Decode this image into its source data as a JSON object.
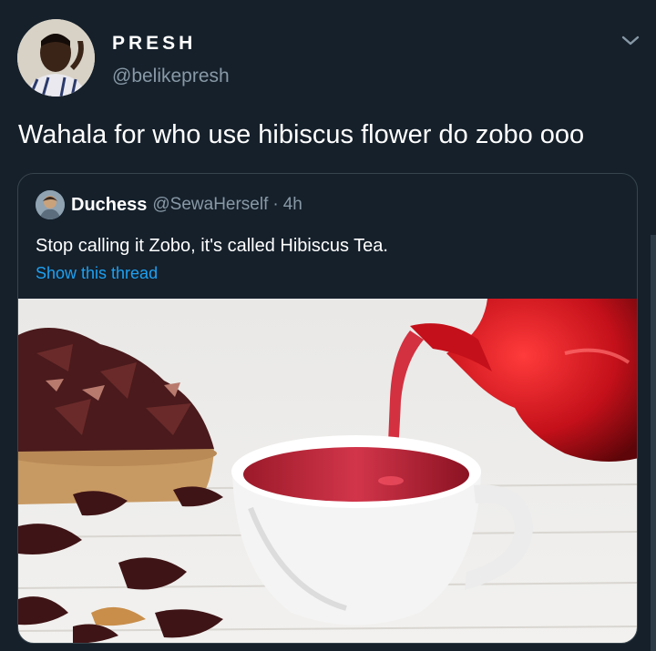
{
  "tweet": {
    "display_name": "PRESH",
    "handle": "@belikepresh",
    "text": "Wahala for who use hibiscus flower do zobo ooo"
  },
  "quoted_tweet": {
    "name": "Duchess",
    "handle": "@SewaHerself",
    "separator": "·",
    "time": "4h",
    "text": "Stop calling it Zobo, it's called Hibiscus Tea.",
    "show_thread_label": "Show this thread"
  },
  "icons": {
    "menu": "chevron-down-icon"
  },
  "colors": {
    "background": "#15202b",
    "secondary_text": "#8899a6",
    "link": "#1da1f2",
    "border": "#38444d"
  }
}
